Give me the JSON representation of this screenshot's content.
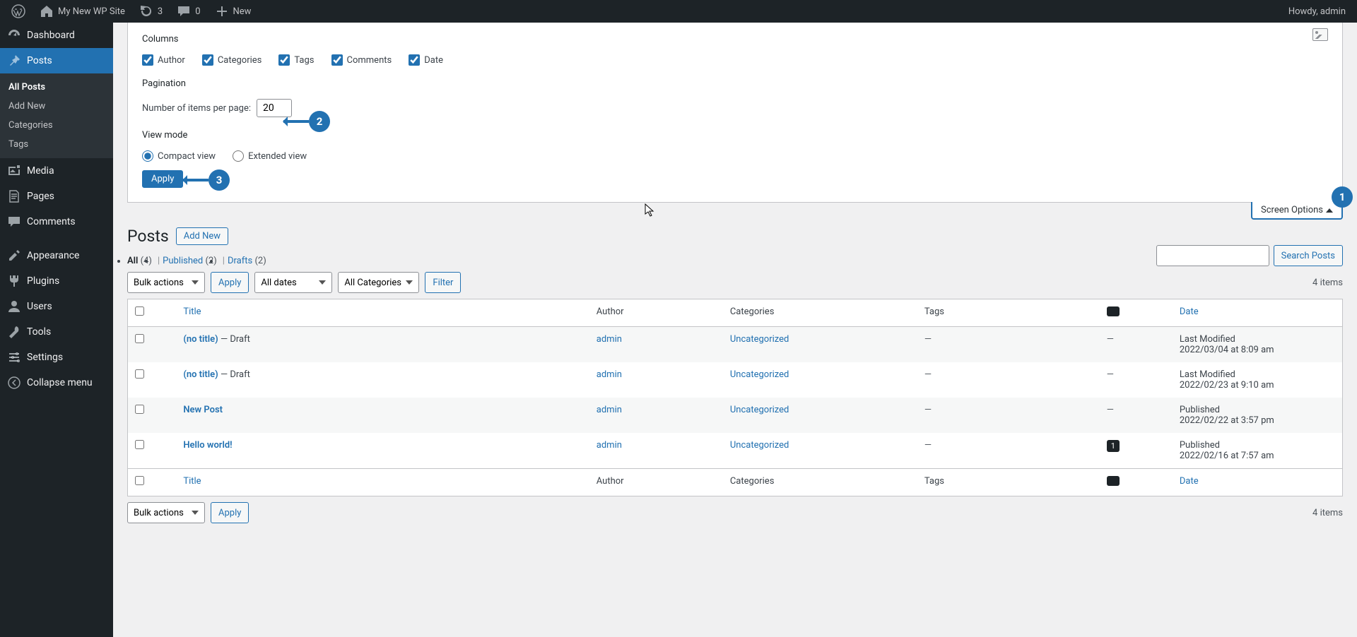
{
  "adminBar": {
    "siteName": "My New WP Site",
    "updates": "3",
    "comments": "0",
    "new": "New",
    "greeting": "Howdy, admin"
  },
  "sidebar": {
    "dashboard": "Dashboard",
    "posts": "Posts",
    "postsSub": {
      "all": "All Posts",
      "addNew": "Add New",
      "categories": "Categories",
      "tags": "Tags"
    },
    "media": "Media",
    "pages": "Pages",
    "commentsMenu": "Comments",
    "appearance": "Appearance",
    "plugins": "Plugins",
    "users": "Users",
    "tools": "Tools",
    "settings": "Settings",
    "collapse": "Collapse menu"
  },
  "screenOptions": {
    "columnsLegend": "Columns",
    "cols": {
      "author": "Author",
      "categories": "Categories",
      "tags": "Tags",
      "comments": "Comments",
      "date": "Date"
    },
    "paginationLegend": "Pagination",
    "itemsLabel": "Number of items per page:",
    "itemsValue": "20",
    "viewModeLegend": "View mode",
    "compact": "Compact view",
    "extended": "Extended view",
    "apply": "Apply",
    "tabLabel": "Screen Options"
  },
  "page": {
    "title": "Posts",
    "addNew": "Add New",
    "searchBtn": "Search Posts"
  },
  "filters": {
    "views": {
      "allLabel": "All",
      "allCount": "(4)",
      "publishedLabel": "Published",
      "publishedCount": "(2)",
      "draftsLabel": "Drafts",
      "draftsCount": "(2)"
    },
    "bulk": "Bulk actions",
    "apply": "Apply",
    "allDates": "All dates",
    "allCategories": "All Categories",
    "filterBtn": "Filter",
    "itemCount": "4 items"
  },
  "table": {
    "headers": {
      "title": "Title",
      "author": "Author",
      "categories": "Categories",
      "tags": "Tags",
      "date": "Date"
    },
    "rows": [
      {
        "title": "(no title)",
        "status": " — Draft",
        "author": "admin",
        "categories": "Uncategorized",
        "tags": "—",
        "comments": "—",
        "dateLabel": "Last Modified",
        "dateValue": "2022/03/04 at 8:09 am"
      },
      {
        "title": "(no title)",
        "status": " — Draft",
        "author": "admin",
        "categories": "Uncategorized",
        "tags": "—",
        "comments": "—",
        "dateLabel": "Last Modified",
        "dateValue": "2022/02/23 at 9:10 am"
      },
      {
        "title": "New Post",
        "status": "",
        "author": "admin",
        "categories": "Uncategorized",
        "tags": "—",
        "comments": "—",
        "dateLabel": "Published",
        "dateValue": "2022/02/22 at 3:57 pm"
      },
      {
        "title": "Hello world!",
        "status": "",
        "author": "admin",
        "categories": "Uncategorized",
        "tags": "—",
        "comments": "1",
        "dateLabel": "Published",
        "dateValue": "2022/02/16 at 7:57 am"
      }
    ]
  },
  "annotations": {
    "n1": "1",
    "n2": "2",
    "n3": "3"
  }
}
